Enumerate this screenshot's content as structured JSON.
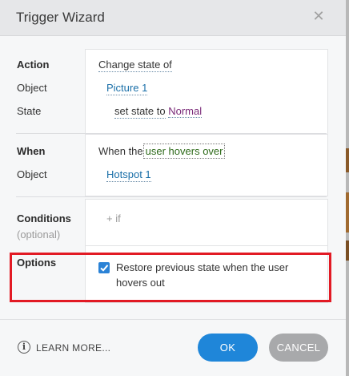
{
  "dialog": {
    "title": "Trigger Wizard",
    "close_icon": "close-icon"
  },
  "rows": {
    "action_label": "Action",
    "object_label": "Object",
    "state_label": "State",
    "when_label": "When",
    "when_object_label": "Object",
    "conditions_label": "Conditions",
    "conditions_sub": "(optional)",
    "options_label": "Options"
  },
  "action": {
    "verb": "Change state of",
    "object": "Picture 1",
    "state_prefix": "set state to",
    "state_value": "Normal"
  },
  "when": {
    "prefix": "When the",
    "event": "user hovers over",
    "object": "Hotspot 1"
  },
  "conditions": {
    "add": "+ if"
  },
  "options": {
    "restore_checked": true,
    "restore_line1": "Restore previous state when the user",
    "restore_line2": "hovers out"
  },
  "footer": {
    "learn_more": "LEARN MORE...",
    "ok": "OK",
    "cancel": "CANCEL"
  },
  "colors": {
    "accent": "#1f86d9",
    "highlight": "#e21a24",
    "cancel": "#a8a9ab"
  }
}
